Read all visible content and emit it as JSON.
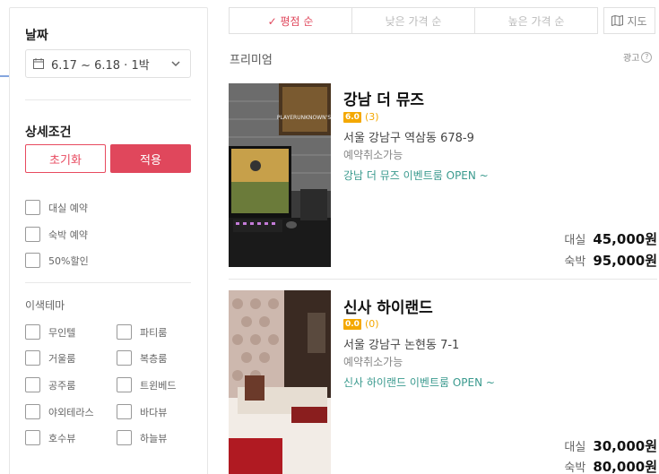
{
  "sidebar": {
    "date_title": "날짜",
    "date_value": "6.17 ~ 6.18 · 1박",
    "filter_title": "상세조건",
    "reset_label": "초기화",
    "apply_label": "적용",
    "options": [
      "대실 예약",
      "숙박 예약",
      "50%할인"
    ],
    "theme_title": "이색테마",
    "themes_left": [
      "무인텔",
      "거울룸",
      "공주룸",
      "야외테라스",
      "호수뷰"
    ],
    "themes_right": [
      "파티룸",
      "복층룸",
      "트윈베드",
      "바다뷰",
      "하늘뷰"
    ]
  },
  "sort": {
    "tabs": [
      "✓ 평점 순",
      "낮은 가격 순",
      "높은 가격 순"
    ],
    "active": 0,
    "map_label": "지도"
  },
  "section": {
    "title": "프리미엄",
    "ad_label": "광고"
  },
  "listings": [
    {
      "name": "강남 더 뮤즈",
      "score": "6.0",
      "reviews": "(3)",
      "address": "서울 강남구 역삼동 678-9",
      "cancel": "예약취소가능",
      "event": "강남 더 뮤즈 이벤트룸 OPEN ~",
      "daily_label": "대실",
      "daily_price": "45,000원",
      "stay_label": "숙박",
      "stay_price": "95,000원"
    },
    {
      "name": "신사 하이랜드",
      "score": "0.0",
      "reviews": "(0)",
      "address": "서울 강남구 논현동 7-1",
      "cancel": "예약취소가능",
      "event": "신사 하이랜드 이벤트룸 OPEN ~",
      "daily_label": "대실",
      "daily_price": "30,000원",
      "stay_label": "숙박",
      "stay_price": "80,000원"
    }
  ],
  "colors": {
    "accent": "#e0475c",
    "rating": "#f4a800",
    "event": "#3a9a8e"
  }
}
